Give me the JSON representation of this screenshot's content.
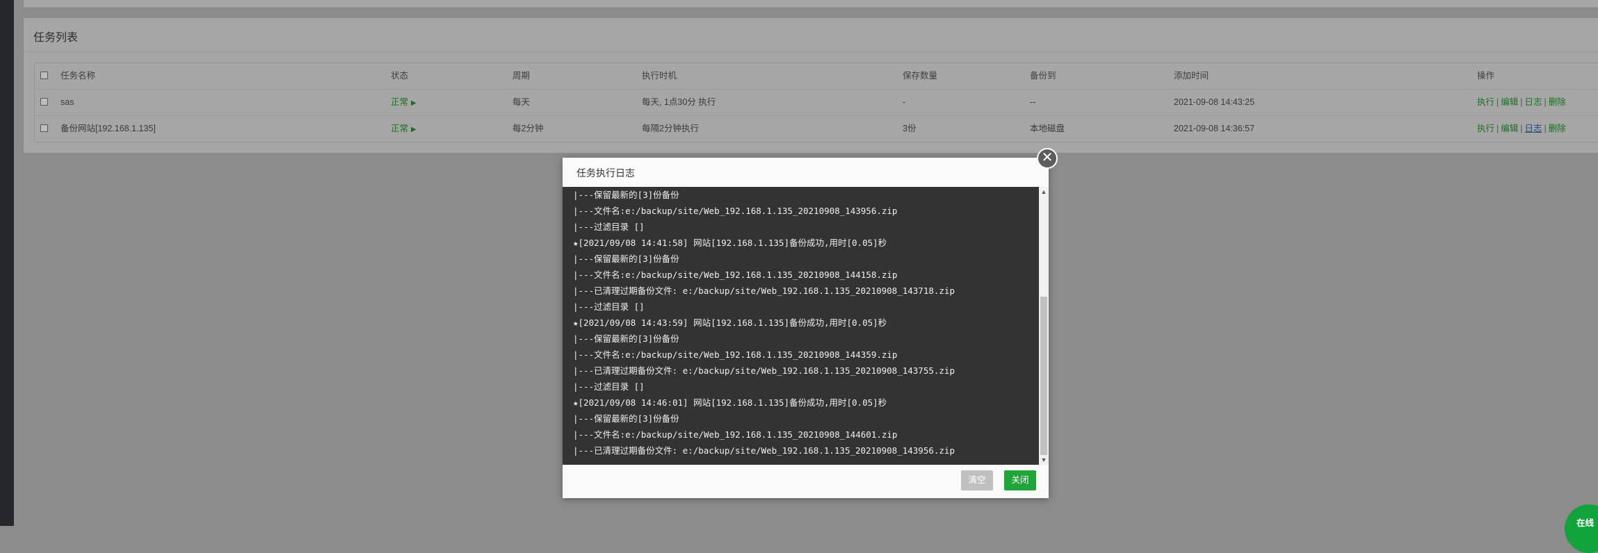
{
  "panel": {
    "title": "任务列表"
  },
  "table": {
    "headers": [
      "任务名称",
      "状态",
      "周期",
      "执行时机",
      "保存数量",
      "备份到",
      "添加时间",
      "操作"
    ],
    "rows": [
      {
        "name": "sas",
        "status": "正常",
        "period": "每天",
        "exec": "每天, 1点30分 执行",
        "count": "-",
        "dest": "--",
        "time": "2021-09-08 14:43:25"
      },
      {
        "name": "备份网站[192.168.1.135]",
        "status": "正常",
        "period": "每2分钟",
        "exec": "每隔2分钟执行",
        "count": "3份",
        "dest": "本地磁盘",
        "time": "2021-09-08 14:36:57"
      }
    ],
    "ops": {
      "run": "执行",
      "edit": "编辑",
      "log": "日志",
      "delete": "删除"
    },
    "status_arrow": "▶"
  },
  "modal": {
    "title": "任务执行日志",
    "log_lines": [
      "|---保留最新的[3]份备份",
      "|---文件名:e:/backup/site/Web_192.168.1.135_20210908_143956.zip",
      "|---过滤目录 []",
      "★[2021/09/08 14:41:58] 网站[192.168.1.135]备份成功,用时[0.05]秒",
      "|---保留最新的[3]份备份",
      "|---文件名:e:/backup/site/Web_192.168.1.135_20210908_144158.zip",
      "|---已清理过期备份文件: e:/backup/site/Web_192.168.1.135_20210908_143718.zip",
      "|---过滤目录 []",
      "★[2021/09/08 14:43:59] 网站[192.168.1.135]备份成功,用时[0.05]秒",
      "|---保留最新的[3]份备份",
      "|---文件名:e:/backup/site/Web_192.168.1.135_20210908_144359.zip",
      "|---已清理过期备份文件: e:/backup/site/Web_192.168.1.135_20210908_143755.zip",
      "|---过滤目录 []",
      "★[2021/09/08 14:46:01] 网站[192.168.1.135]备份成功,用时[0.05]秒",
      "|---保留最新的[3]份备份",
      "|---文件名:e:/backup/site/Web_192.168.1.135_20210908_144601.zip",
      "|---已清理过期备份文件: e:/backup/site/Web_192.168.1.135_20210908_143956.zip"
    ],
    "clear_label": "清空",
    "close_label": "关闭",
    "close_icon": "✕"
  },
  "online_badge": "在线",
  "colors": {
    "accent": "#20a53a",
    "log_bg": "#333333"
  }
}
